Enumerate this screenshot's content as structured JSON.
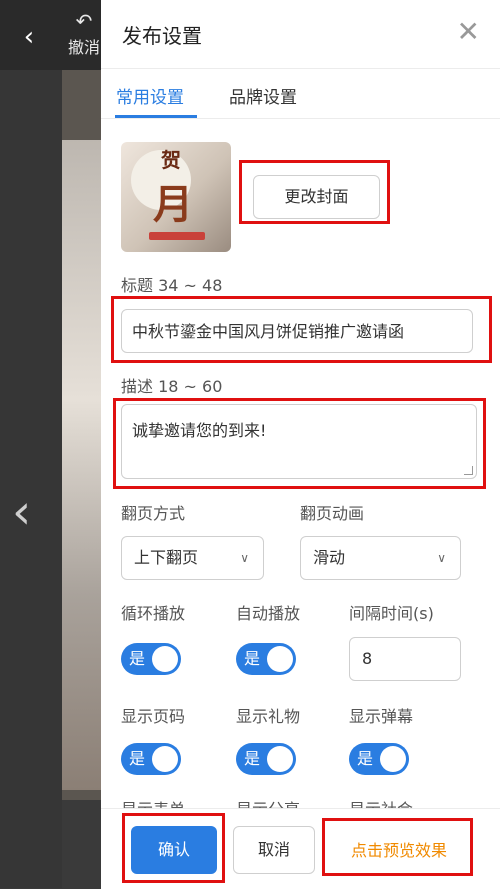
{
  "editor": {
    "undo_label": "撤消"
  },
  "panel": {
    "title": "发布设置",
    "tabs": [
      "常用设置",
      "品牌设置"
    ],
    "change_cover_label": "更改封面",
    "title_label": "标题 34 ~ 48",
    "title_value": "中秋节鎏金中国风月饼促销推广邀请函",
    "description_label": "描述 18 ~ 60",
    "description_value": "诚挚邀请您的到来!",
    "flip_mode_label": "翻页方式",
    "flip_mode_value": "上下翻页",
    "flip_anim_label": "翻页动画",
    "flip_anim_value": "滑动",
    "loop_label": "循环播放",
    "autoplay_label": "自动播放",
    "interval_label": "间隔时间(s)",
    "interval_value": "8",
    "show_page_label": "显示页码",
    "show_gift_label": "显示礼物",
    "show_danmaku_label": "显示弹幕",
    "toggle_on_label": "是",
    "partial_row": [
      "显示表单",
      "显示分享",
      "显示社会"
    ],
    "confirm_label": "确认",
    "cancel_label": "取消",
    "preview_label": "点击预览效果",
    "cover_text_top": "贺",
    "cover_text_main": "月"
  },
  "colors": {
    "accent": "#2a7de1",
    "preview": "#f08a00",
    "annotation": "#e01010"
  }
}
